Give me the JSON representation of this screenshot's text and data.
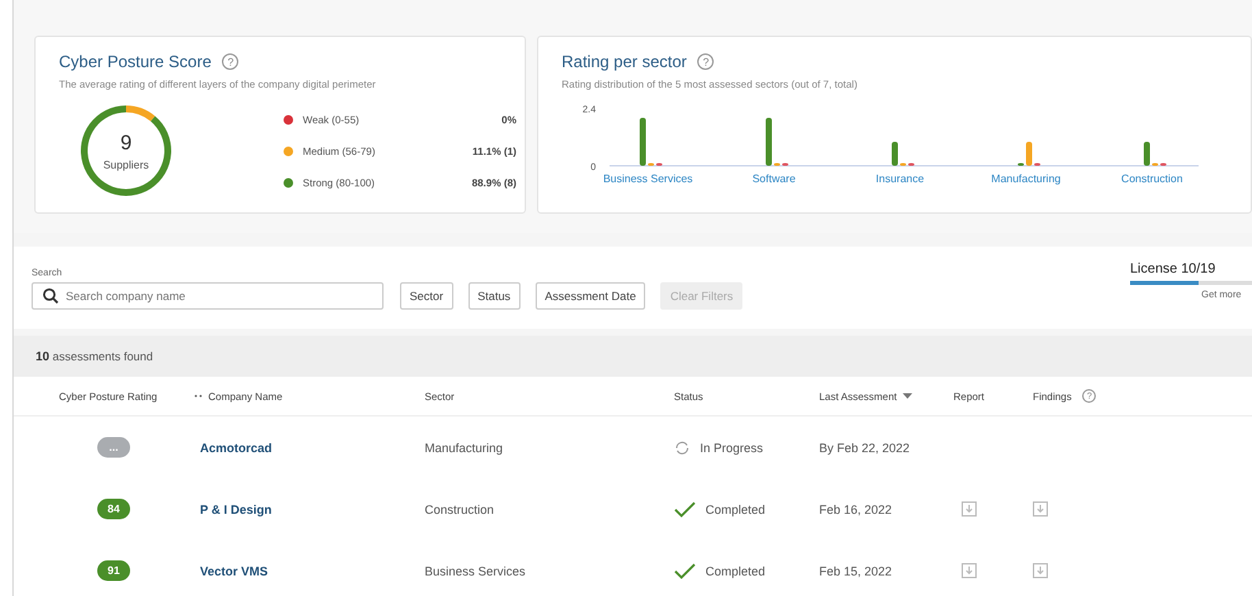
{
  "score_card": {
    "title": "Cyber Posture Score",
    "help": "?",
    "subtitle": "The average rating of different layers of the company digital perimeter",
    "total": "9",
    "total_label": "Suppliers",
    "chart_data": {
      "type": "donut",
      "values": [
        0,
        11.1,
        88.9
      ]
    },
    "legend": [
      {
        "label": "Weak (0-55)",
        "value": "0%",
        "color": "#d9323a"
      },
      {
        "label": "Medium (56-79)",
        "value": "11.1% (1)",
        "color": "#f5a623"
      },
      {
        "label": "Strong (80-100)",
        "value": "88.9% (8)",
        "color": "#4a8f2a"
      }
    ]
  },
  "sector_card": {
    "title": "Rating per sector",
    "help": "?",
    "subtitle": "Rating distribution of the 5 most assessed sectors (out of 7, total)",
    "chart_data": {
      "type": "bar",
      "categories": [
        "Business Services",
        "Software",
        "Insurance",
        "Manufacturing",
        "Construction"
      ],
      "ylim": [
        0,
        2.4
      ],
      "yticks": [
        0,
        2.4
      ],
      "series": [
        {
          "color": "#4a8f2a",
          "values": [
            2,
            2,
            1,
            0,
            1
          ]
        },
        {
          "color": "#f5a623",
          "values": [
            0,
            0,
            0,
            1,
            0
          ]
        },
        {
          "color": "#e05560",
          "values": [
            0,
            0,
            0,
            0,
            0
          ]
        }
      ]
    }
  },
  "filters": {
    "search_label": "Search",
    "placeholder": "Search company name",
    "buttons": [
      {
        "label": "Sector",
        "disabled": false
      },
      {
        "label": "Status",
        "disabled": false
      },
      {
        "label": "Assessment Date",
        "disabled": false
      },
      {
        "label": "Clear Filters",
        "disabled": true
      }
    ]
  },
  "license": {
    "label": "License 10/19",
    "level": 0.53,
    "link": "Get more"
  },
  "results": {
    "count": "10",
    "count_label": "assessments found"
  },
  "table": {
    "columns": [
      {
        "label": "Cyber Posture Rating"
      },
      {
        "label": "Company Name"
      },
      {
        "label": "Sector"
      },
      {
        "label": "Status"
      },
      {
        "label": "Last Assessment"
      },
      {
        "label": "Report"
      },
      {
        "label": "Findings",
        "help": "?"
      }
    ],
    "rows": [
      {
        "rating": "...",
        "color": "#a9acb0",
        "company": "Acmotorcad",
        "sector": "Manufacturing",
        "status": "In Progress",
        "kind": "in_progress",
        "date": "By Feb 22, 2022",
        "report": false,
        "findings": false
      },
      {
        "rating": "84",
        "color": "#4a8f2a",
        "company": "P & I Design",
        "sector": "Construction",
        "status": "Completed",
        "kind": "completed",
        "date": "Feb 16, 2022",
        "report": true,
        "findings": true
      },
      {
        "rating": "91",
        "color": "#4a8f2a",
        "company": "Vector VMS",
        "sector": "Business Services",
        "status": "Completed",
        "kind": "completed",
        "date": "Feb 15, 2022",
        "report": true,
        "findings": true
      }
    ]
  }
}
